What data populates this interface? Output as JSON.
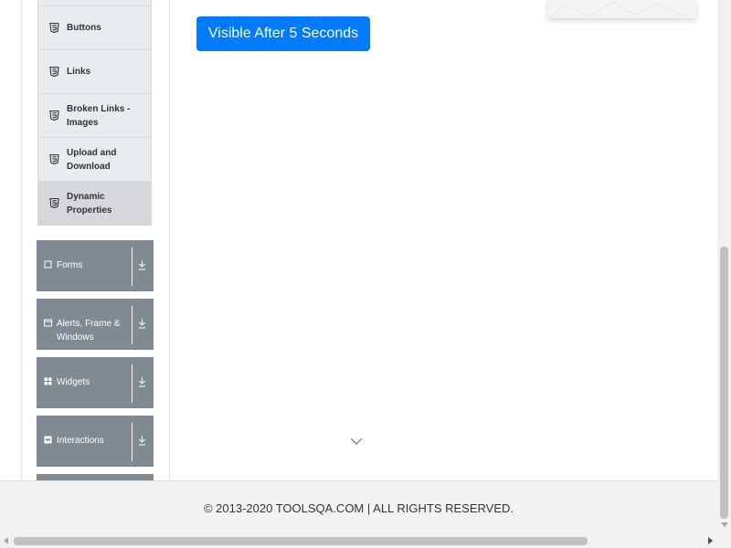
{
  "sidebar": {
    "elements_items": [
      {
        "label": "",
        "icon": "html5-icon"
      },
      {
        "label": "Buttons",
        "icon": "html5-icon"
      },
      {
        "label": "Links",
        "icon": "html5-icon"
      },
      {
        "label": "Broken Links - Images",
        "icon": "html5-icon"
      },
      {
        "label": "Upload and Download",
        "icon": "html5-icon"
      },
      {
        "label": "Dynamic Properties",
        "icon": "html5-icon",
        "active": true
      }
    ],
    "groups": [
      {
        "label": "Forms",
        "icon": "form-icon"
      },
      {
        "label": "Alerts, Frame & Windows",
        "icon": "window-icon"
      },
      {
        "label": "Widgets",
        "icon": "widgets-grid-icon"
      },
      {
        "label": "Interactions",
        "icon": "interactions-icon"
      }
    ]
  },
  "main": {
    "visible_after_button": "Visible After 5 Seconds",
    "scroll_hint_icon": "chevron-down-icon"
  },
  "footer": {
    "copyright": "© 2013-2020 TOOLSQA.COM | ALL RIGHTS RESERVED."
  },
  "colors": {
    "primary_button": "#007bff",
    "group_header": "#808a93",
    "menu_item_bg": "#e9ecef",
    "menu_item_active_bg": "#d5d7da"
  }
}
